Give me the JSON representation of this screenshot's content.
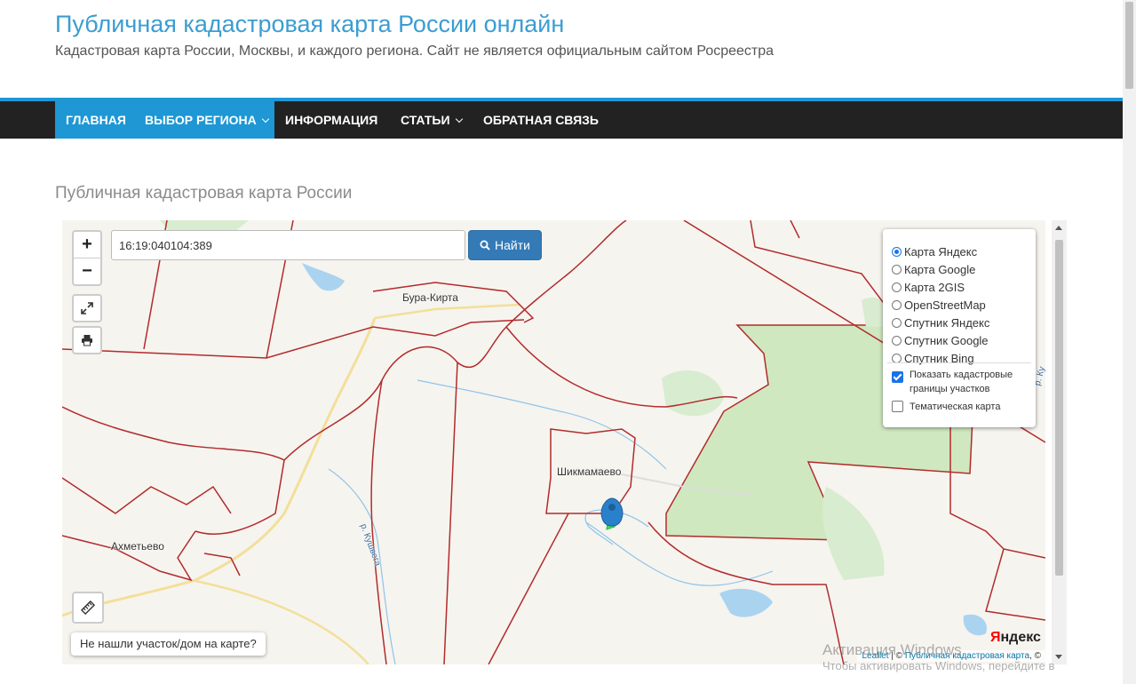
{
  "site": {
    "title": "Публичная кадастровая карта России онлайн",
    "description": "Кадастровая карта России, Москвы, и каждого региона. Сайт не является официальным сайтом Росреестра"
  },
  "nav": {
    "items": [
      {
        "label": "ГЛАВНАЯ",
        "active": true,
        "dropdown": false
      },
      {
        "label": "ВЫБОР РЕГИОНА",
        "active": true,
        "dropdown": true
      },
      {
        "label": "ИНФОРМАЦИЯ",
        "active": false,
        "dropdown": false
      },
      {
        "label": "СТАТЬИ",
        "active": false,
        "dropdown": true
      },
      {
        "label": "ОБРАТНАЯ СВЯЗЬ",
        "active": false,
        "dropdown": false
      }
    ]
  },
  "page": {
    "title": "Публичная кадастровая карта России"
  },
  "map": {
    "zoom_in": "+",
    "zoom_out": "−",
    "search": {
      "value": "16:19:040104:389",
      "button_label": "Найти"
    },
    "layers": {
      "options": [
        "Карта Яндекс",
        "Карта Google",
        "Карта 2GIS",
        "OpenStreetMap",
        "Спутник Яндекс",
        "Спутник Google",
        "Спутник Bing"
      ],
      "selected": "Карта Яндекс",
      "show_cadastral": "Показать кадастровые границы участков",
      "show_cadastral_checked": true,
      "thematic": "Тематическая карта",
      "thematic_checked": false
    },
    "labels": {
      "bura_kirta": "Бура-Кирта",
      "shikmamaevo": "Шикмамаево",
      "akhmetevo": "Ахметьево",
      "river_kushvega": "р. Кушвега",
      "river_edge": "р. Ку"
    },
    "not_found": "Не нашли участок/дом на карте?",
    "provider_brand": {
      "main": "ндекс",
      "first_letter": "Я"
    },
    "attribution": {
      "leaflet": "Leaflet",
      "sep": " | © ",
      "site": "Публичная кадастровая карта",
      "tail": ", ©"
    }
  },
  "watermark": {
    "line1": "Активация Windows",
    "line2": "Чтобы активировать Windows, перейдите в"
  },
  "colors": {
    "accent": "#1e97d4",
    "nav_bg": "#222222",
    "button": "#337ab7",
    "cadastral_border": "#b22b2b",
    "forest": "#cfe8c0"
  }
}
